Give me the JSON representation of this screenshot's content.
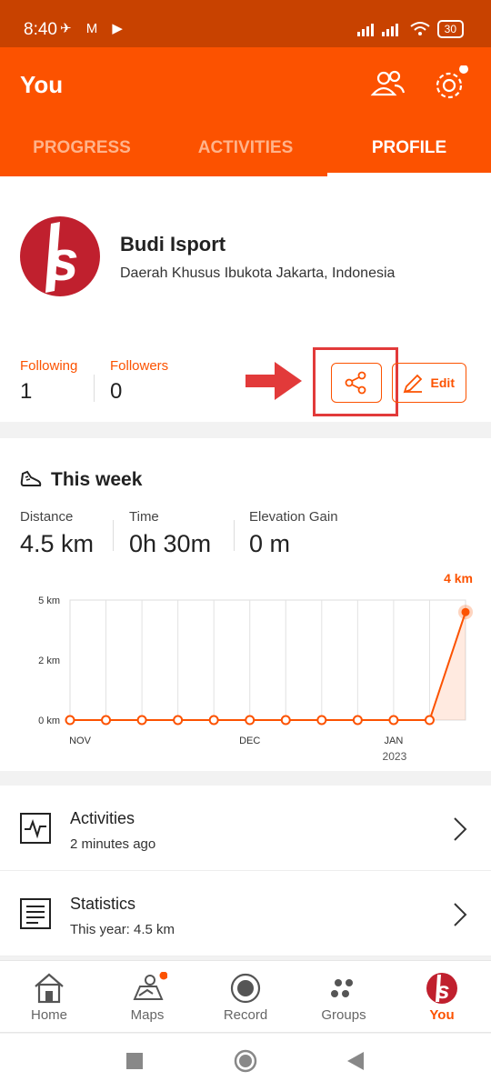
{
  "status_bar": {
    "time": "8:40",
    "battery": "30"
  },
  "app_bar": {
    "title": "You"
  },
  "tabs": [
    {
      "label": "PROGRESS",
      "active": false
    },
    {
      "label": "ACTIVITIES",
      "active": false
    },
    {
      "label": "PROFILE",
      "active": true
    }
  ],
  "profile": {
    "name": "Budi Isport",
    "location": "Daerah Khusus Ibukota Jakarta, Indonesia",
    "following_label": "Following",
    "following_count": "1",
    "followers_label": "Followers",
    "followers_count": "0",
    "edit_label": "Edit"
  },
  "this_week": {
    "title": "This week",
    "stats": [
      {
        "label": "Distance",
        "value": "4.5 km"
      },
      {
        "label": "Time",
        "value": "0h 30m"
      },
      {
        "label": "Elevation Gain",
        "value": "0 m"
      }
    ]
  },
  "chart_data": {
    "type": "line",
    "x": [
      "NOV",
      "",
      "",
      "",
      "",
      "DEC",
      "",
      "",
      "",
      "JAN",
      "",
      ""
    ],
    "x_sub_label": "2023",
    "values": [
      0,
      0,
      0,
      0,
      0,
      0,
      0,
      0,
      0,
      0,
      0,
      4.5
    ],
    "ytick_labels": [
      "0 km",
      "2 km",
      "5 km"
    ],
    "yticks": [
      0,
      2.5,
      5
    ],
    "ylim": [
      0,
      5
    ],
    "highlight_label": "4 km",
    "color": "#fc5200"
  },
  "list": [
    {
      "title": "Activities",
      "subtitle": "2 minutes ago",
      "icon": "activity-chart-icon"
    },
    {
      "title": "Statistics",
      "subtitle": "This year: 4.5 km",
      "icon": "statistics-icon"
    }
  ],
  "bottom_nav": [
    {
      "label": "Home",
      "icon": "home-icon"
    },
    {
      "label": "Maps",
      "icon": "maps-icon"
    },
    {
      "label": "Record",
      "icon": "record-icon"
    },
    {
      "label": "Groups",
      "icon": "groups-icon"
    },
    {
      "label": "You",
      "icon": "you-avatar-icon"
    }
  ],
  "colors": {
    "brand": "#fc5200",
    "status_bar": "#c84200",
    "highlight": "#e23a3a"
  }
}
